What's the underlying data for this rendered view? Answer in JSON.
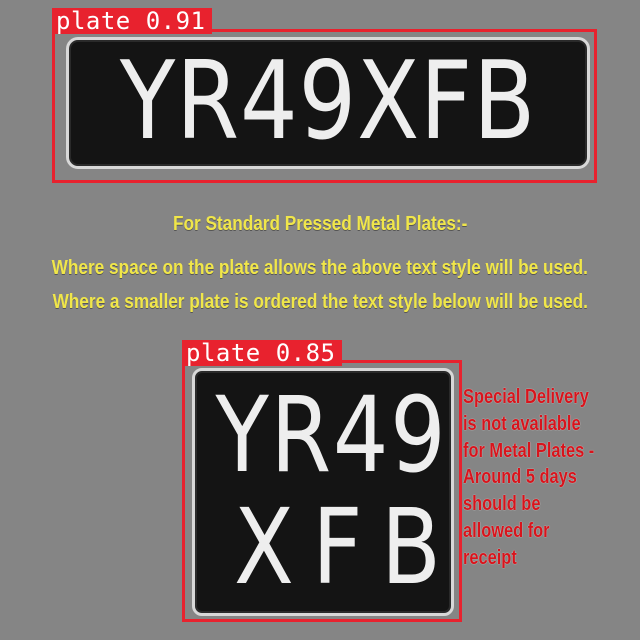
{
  "plate_top": {
    "text": "YR49XFB"
  },
  "plate_bottom": {
    "line1": "YR49",
    "line2": "XFB"
  },
  "detections": [
    {
      "label": "plate 0.91"
    },
    {
      "label": "plate 0.85"
    }
  ],
  "caption": {
    "heading": "For Standard Pressed Metal Plates:-",
    "line1": "Where space on the plate allows the above text style will be used.",
    "line2": "Where a smaller plate is ordered the text style below will be used."
  },
  "notice": {
    "lines": [
      "Special Delivery",
      "is not available",
      "for Metal Plates -",
      "Around 5 days",
      "should be",
      "allowed for",
      "receipt"
    ]
  },
  "colors": {
    "background": "#858585",
    "detection_box": "#e8222e",
    "caption_text": "#f0e64a",
    "notice_text": "#d8141c"
  }
}
